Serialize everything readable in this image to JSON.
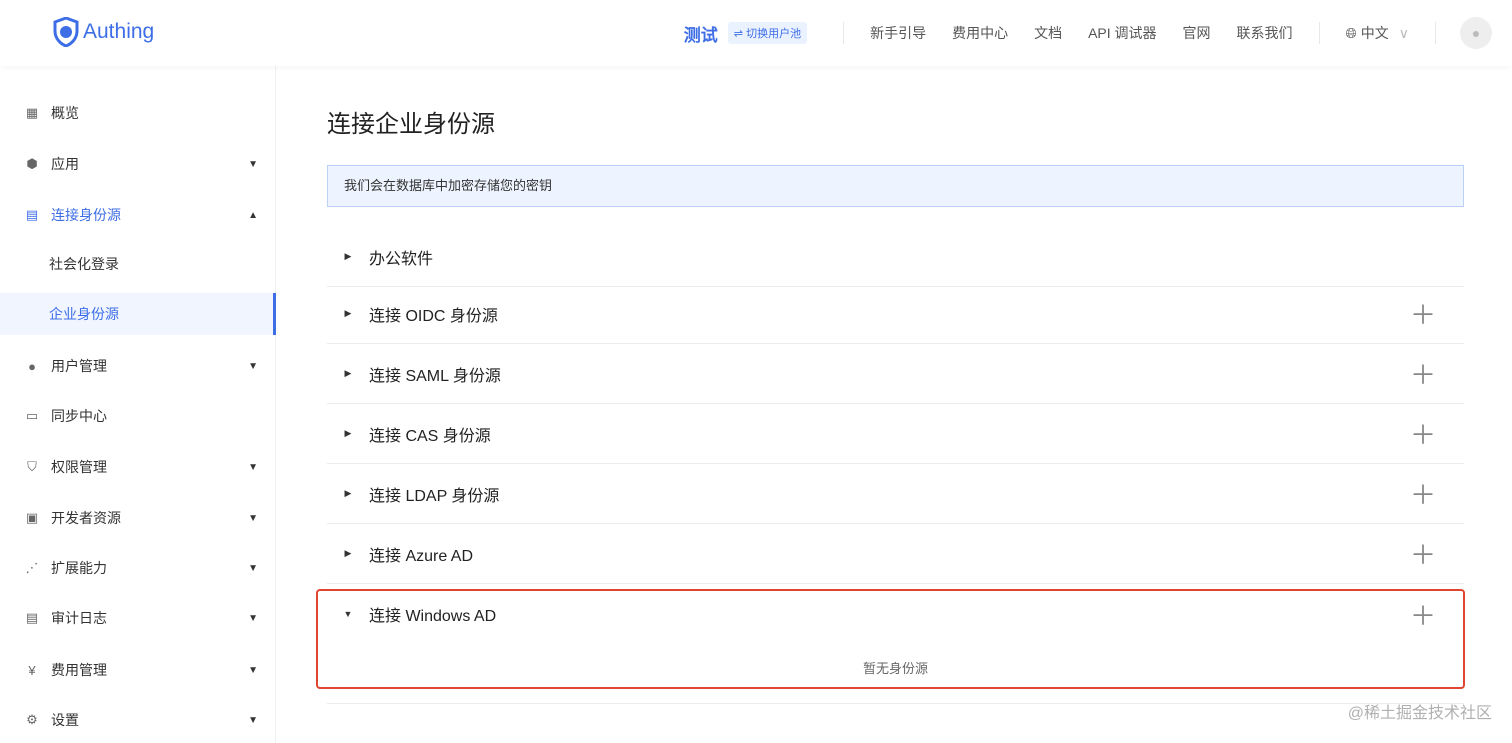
{
  "header": {
    "logo": "Authing",
    "pool": "测试",
    "switch": "切换用户池",
    "links": [
      "新手引导",
      "费用中心",
      "文档",
      "API 调试器",
      "官网",
      "联系我们"
    ],
    "lang": "中文"
  },
  "sidebar": [
    {
      "label": "概览",
      "icon": "dashboard-icon"
    },
    {
      "label": "应用",
      "icon": "cube-icon",
      "chev": "down"
    },
    {
      "label": "连接身份源",
      "icon": "id-card-icon",
      "chev": "up"
    },
    {
      "label": "社会化登录",
      "sub": true
    },
    {
      "label": "企业身份源",
      "sub": true,
      "active": true
    },
    {
      "label": "用户管理",
      "icon": "user-icon",
      "chev": "down"
    },
    {
      "label": "同步中心",
      "icon": "sync-icon"
    },
    {
      "label": "权限管理",
      "icon": "shield-icon",
      "chev": "down"
    },
    {
      "label": "开发者资源",
      "icon": "code-icon",
      "chev": "down"
    },
    {
      "label": "扩展能力",
      "icon": "share-icon",
      "chev": "down"
    },
    {
      "label": "审计日志",
      "icon": "log-icon",
      "chev": "down"
    },
    {
      "label": "费用管理",
      "icon": "yen-icon",
      "chev": "down"
    },
    {
      "label": "设置",
      "icon": "gear-icon",
      "chev": "down"
    }
  ],
  "main": {
    "title": "连接企业身份源",
    "info": "我们会在数据库中加密存储您的密钥",
    "rows": [
      {
        "label": "办公软件",
        "plus": false
      },
      {
        "label": "连接 OIDC 身份源",
        "plus": true
      },
      {
        "label": "连接 SAML 身份源",
        "plus": true
      },
      {
        "label": "连接 CAS 身份源",
        "plus": true
      },
      {
        "label": "连接 LDAP 身份源",
        "plus": true
      },
      {
        "label": "连接 Azure AD",
        "plus": true
      },
      {
        "label": "连接 Windows AD",
        "plus": true,
        "expanded": true
      }
    ],
    "empty": "暂无身份源"
  },
  "watermark": "@稀土掘金技术社区"
}
